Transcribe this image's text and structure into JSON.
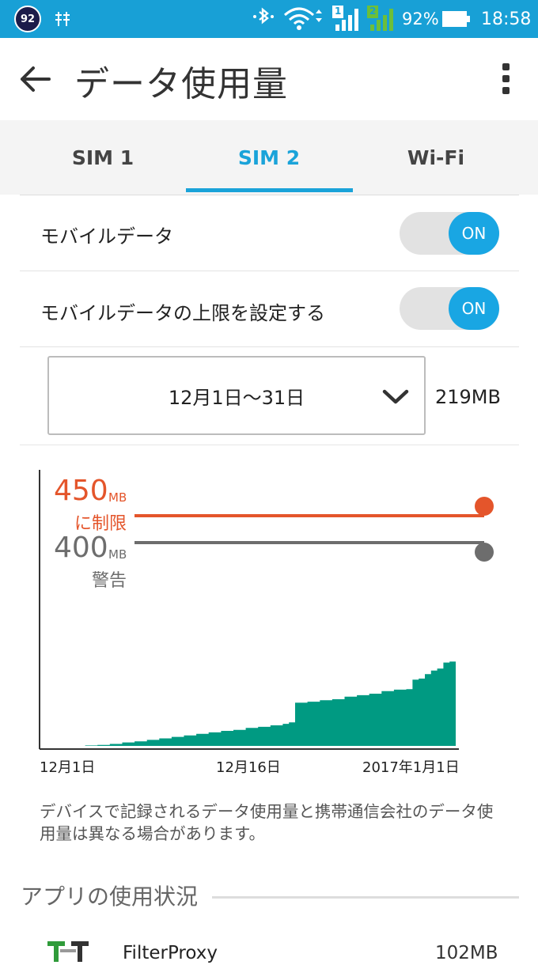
{
  "status_bar": {
    "notification_badge": "92",
    "battery_percent": "92%",
    "time": "18:58",
    "sim1_number": "1",
    "sim2_number": "2",
    "colors": {
      "background": "#18a0d6"
    },
    "icons": [
      "usb-debug-icon",
      "bluetooth-icon",
      "wifi-icon",
      "sim1-signal-icon",
      "sim2-signal-icon",
      "battery-icon"
    ]
  },
  "app_bar": {
    "title": "データ使用量",
    "icons": [
      "back-arrow-icon",
      "overflow-menu-icon"
    ]
  },
  "tabs": [
    {
      "label": "SIM 1",
      "active": false
    },
    {
      "label": "SIM 2",
      "active": true
    },
    {
      "label": "Wi-Fi",
      "active": false
    }
  ],
  "settings": {
    "mobile_data": {
      "label": "モバイルデータ",
      "toggle": "ON"
    },
    "data_limit": {
      "label": "モバイルデータの上限を設定する",
      "toggle": "ON"
    }
  },
  "cycle": {
    "range": "12月1日〜31日",
    "total": "219MB"
  },
  "chart_data": {
    "type": "area",
    "x_tick_labels": [
      "12月1日",
      "12月16日",
      "2017年1月1日"
    ],
    "unit": "MB",
    "limit": {
      "value": 450,
      "unit": "MB",
      "label": "に制限",
      "color": "#e4552b"
    },
    "warning": {
      "value": 400,
      "unit": "MB",
      "label": "警告",
      "color": "#6d6d6d"
    },
    "series_color": "#009a82",
    "x_range_days": [
      0,
      31
    ],
    "points": [
      [
        0.0,
        0
      ],
      [
        1.0,
        1
      ],
      [
        2.0,
        2
      ],
      [
        3.0,
        4
      ],
      [
        4.0,
        7
      ],
      [
        5.0,
        9
      ],
      [
        6.0,
        12
      ],
      [
        7.0,
        15
      ],
      [
        8.0,
        18
      ],
      [
        9.0,
        21
      ],
      [
        10.0,
        24
      ],
      [
        11.0,
        27
      ],
      [
        12.0,
        30
      ],
      [
        13.0,
        32
      ],
      [
        14.0,
        36
      ],
      [
        15.0,
        38
      ],
      [
        16.0,
        41
      ],
      [
        17.0,
        44
      ],
      [
        17.5,
        47
      ],
      [
        18.0,
        86
      ],
      [
        19.0,
        88
      ],
      [
        20.0,
        91
      ],
      [
        21.0,
        93
      ],
      [
        22.0,
        98
      ],
      [
        23.0,
        101
      ],
      [
        24.0,
        104
      ],
      [
        25.0,
        109
      ],
      [
        26.0,
        112
      ],
      [
        27.0,
        113
      ],
      [
        27.5,
        132
      ],
      [
        28.0,
        134
      ],
      [
        28.5,
        143
      ],
      [
        29.0,
        150
      ],
      [
        29.5,
        154
      ],
      [
        30.0,
        166
      ],
      [
        30.5,
        168
      ],
      [
        31.0,
        219
      ]
    ]
  },
  "note": "デバイスで記録されるデータ使用量と携帯通信会社のデータ使用量は異なる場合があります。",
  "apps_section": {
    "title": "アプリの使用状況",
    "apps": [
      {
        "name": "FilterProxy",
        "usage": "102MB"
      }
    ]
  }
}
